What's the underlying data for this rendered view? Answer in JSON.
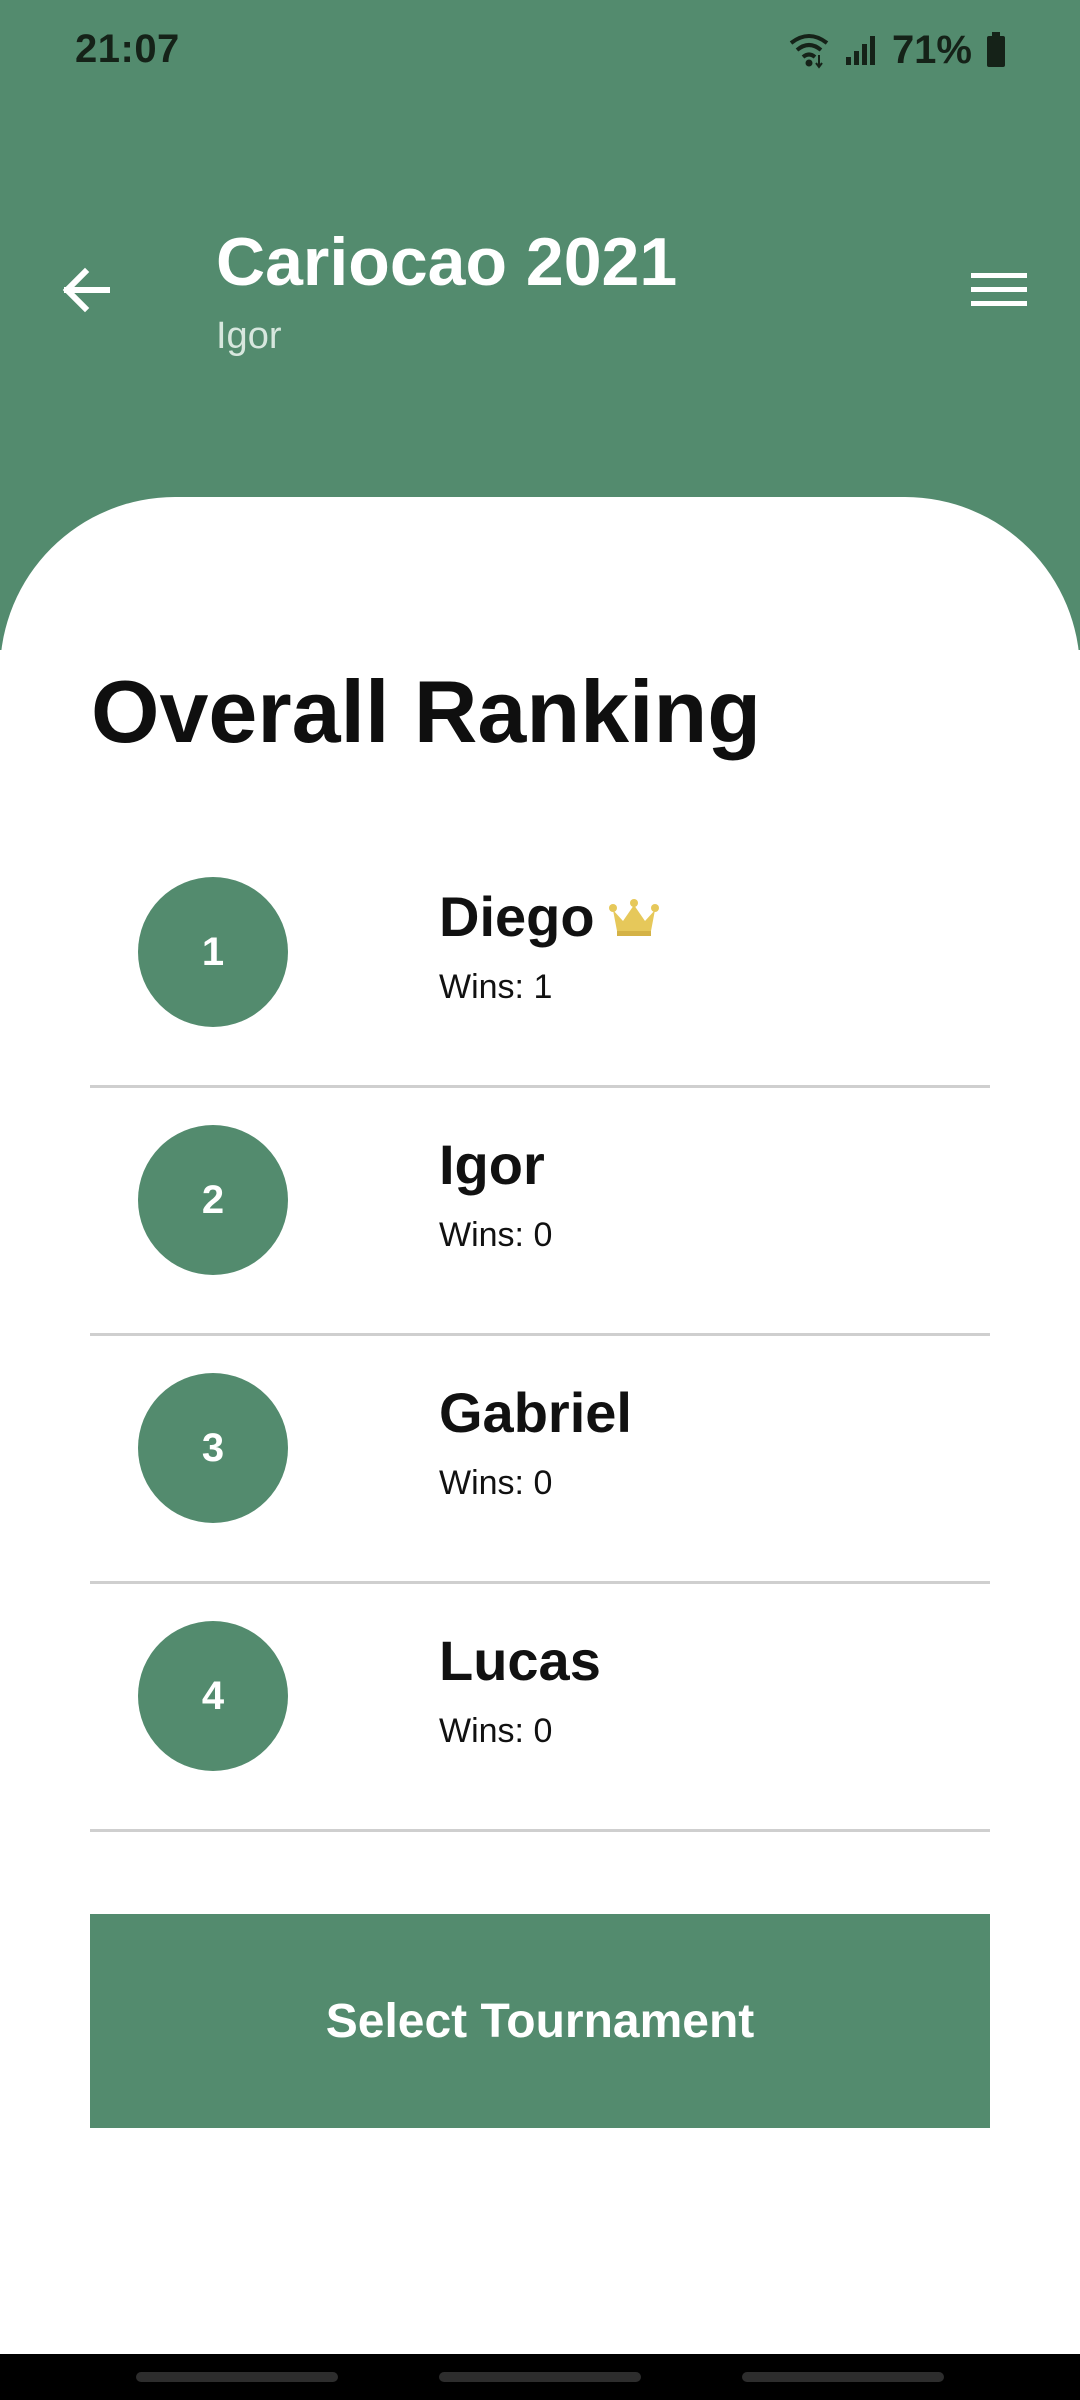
{
  "status_bar": {
    "time": "21:07",
    "battery": "71%",
    "icons": [
      "wifi-icon",
      "signal-icon",
      "battery-icon"
    ]
  },
  "header": {
    "title": "Cariocao 2021",
    "subtitle": "Igor",
    "back_icon": "arrow-left-icon",
    "menu_icon": "hamburger-menu-icon"
  },
  "section": {
    "title": "Overall Ranking"
  },
  "ranking": [
    {
      "position": "1",
      "name": "Diego",
      "wins": "Wins: 1",
      "crown": true
    },
    {
      "position": "2",
      "name": "Igor",
      "wins": "Wins: 0",
      "crown": false
    },
    {
      "position": "3",
      "name": "Gabriel",
      "wins": "Wins: 0",
      "crown": false
    },
    {
      "position": "4",
      "name": "Lucas",
      "wins": "Wins: 0",
      "crown": false
    }
  ],
  "actions": {
    "select_tournament": "Select Tournament"
  },
  "colors": {
    "primary": "#538b6e",
    "header_subtitle": "#d7e7de",
    "divider": "#cfcfcf",
    "crown": "#e6c85a"
  }
}
